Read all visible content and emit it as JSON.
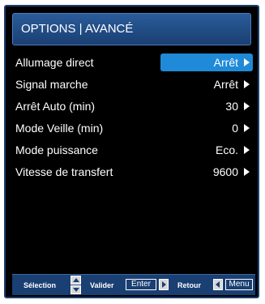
{
  "header": {
    "title": "OPTIONS  |  AVANCÉ"
  },
  "rows": [
    {
      "label": "Allumage direct",
      "value": "Arrêt"
    },
    {
      "label": "Signal marche",
      "value": "Arrêt"
    },
    {
      "label": "Arrêt Auto (min)",
      "value": "30"
    },
    {
      "label": "Mode Veille (min)",
      "value": "0"
    },
    {
      "label": "Mode puissance",
      "value": "Eco."
    },
    {
      "label": "Vitesse de transfert",
      "value": "9600"
    }
  ],
  "footer": {
    "selection_label": "Sélection",
    "valider_label": "Valider",
    "enter_key": "Enter",
    "retour_label": "Retour",
    "menu_key": "Menu"
  },
  "colors": {
    "highlight": "#1f8ad8",
    "header_bg": "#1a3f72",
    "panel_bg": "#000000"
  }
}
